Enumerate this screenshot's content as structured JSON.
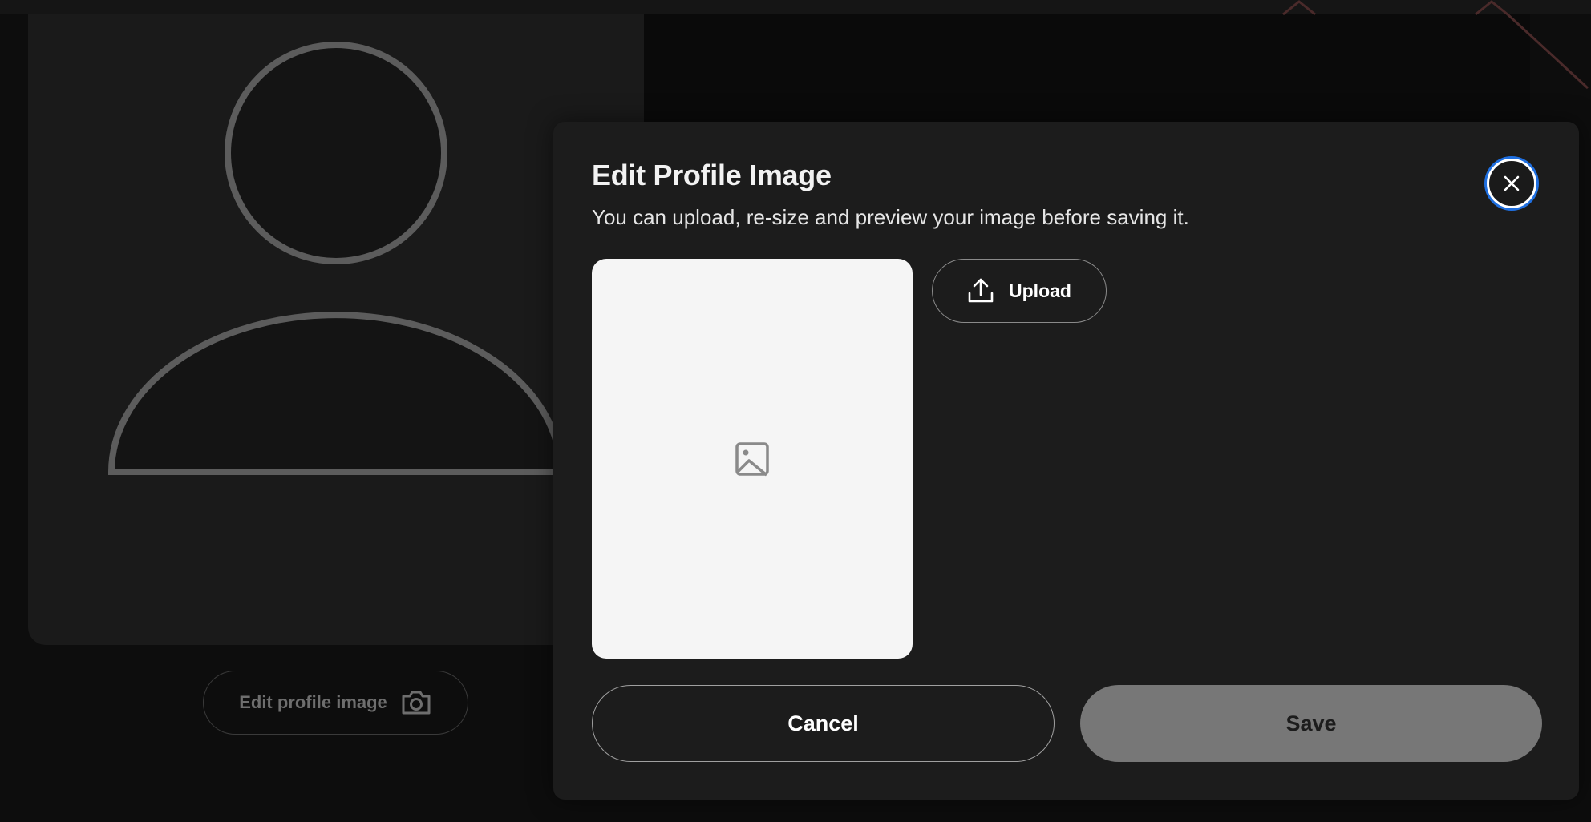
{
  "background": {
    "edit_profile_button_label": "Edit profile image",
    "edit_profile_icon": "camera-icon",
    "avatar_icon": "user-placeholder-icon"
  },
  "modal": {
    "title": "Edit Profile Image",
    "subtitle": "You can upload, re-size and preview your image before saving it.",
    "close_icon": "close-icon",
    "preview_icon": "image-placeholder-icon",
    "upload_label": "Upload",
    "upload_icon": "upload-icon",
    "cancel_label": "Cancel",
    "save_label": "Save",
    "colors": {
      "focus_ring": "#1f6fe0",
      "save_disabled_bg": "#777777",
      "modal_bg": "#1c1c1c"
    }
  }
}
